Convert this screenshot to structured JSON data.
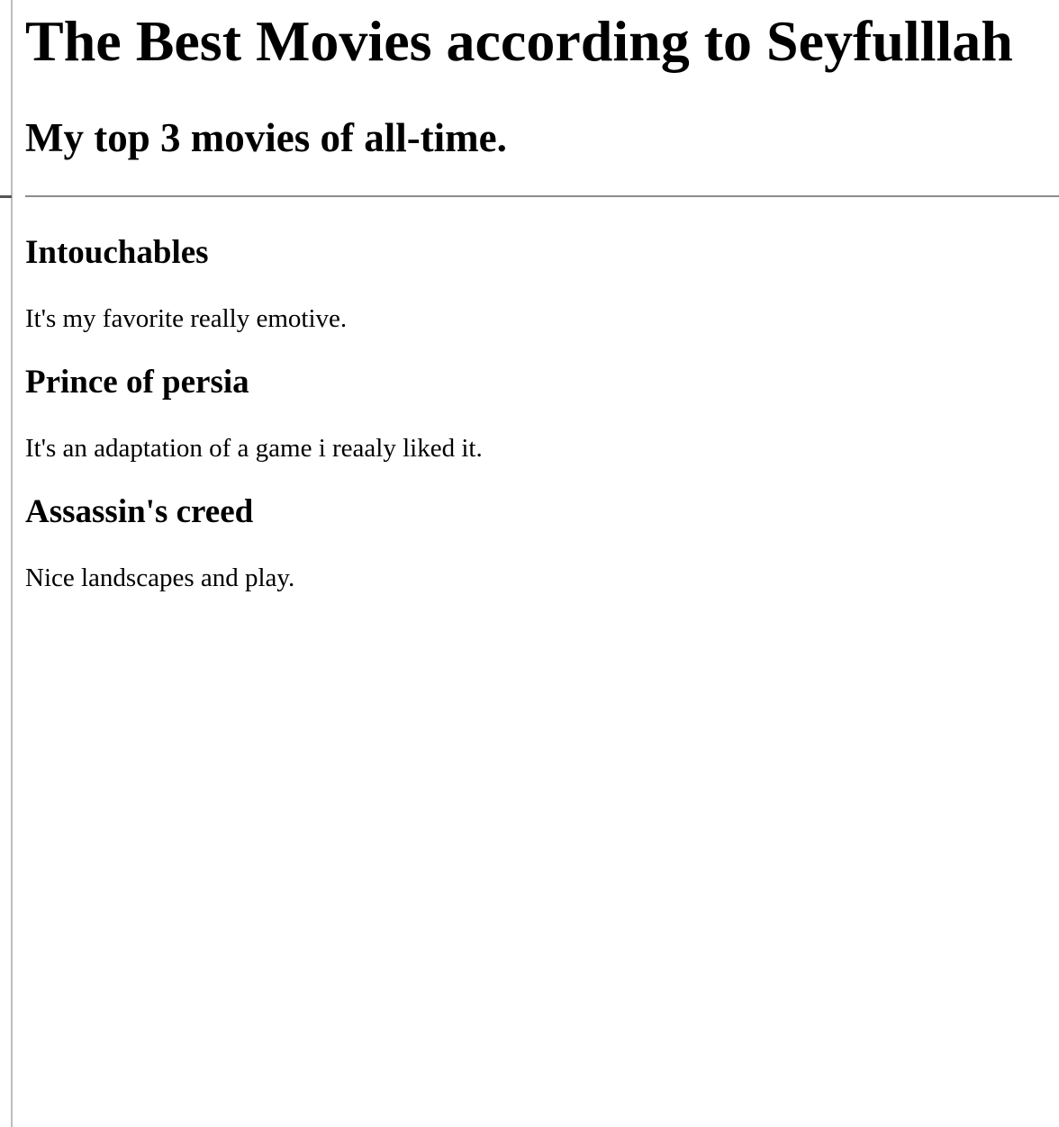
{
  "page": {
    "title": "The Best Movies according to Seyfulllah",
    "subtitle": "My top 3 movies of all-time."
  },
  "movies": [
    {
      "title": "Intouchables",
      "description": "It's my favorite really emotive."
    },
    {
      "title": "Prince of persia",
      "description": "It's an adaptation of a game i reaaly liked it."
    },
    {
      "title": "Assassin's creed",
      "description": "Nice landscapes and play."
    }
  ]
}
